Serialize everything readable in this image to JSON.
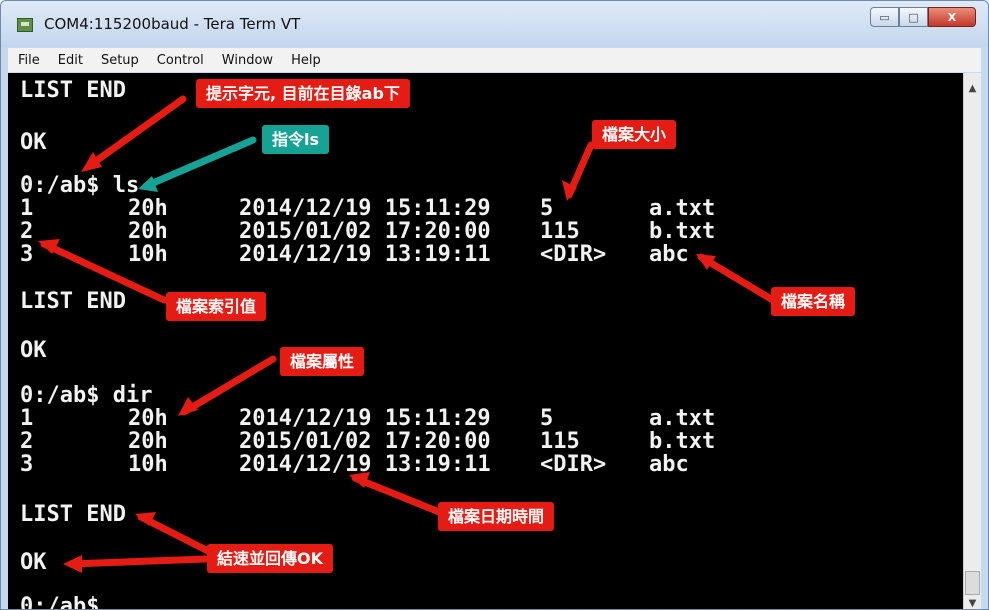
{
  "window": {
    "title": "COM4:115200baud - Tera Term VT",
    "buttons": {
      "minimize": "▭",
      "maximize": "□",
      "close": "X"
    }
  },
  "menu": [
    "File",
    "Edit",
    "Setup",
    "Control",
    "Window",
    "Help"
  ],
  "terminal": {
    "line1": "LIST END",
    "line2": "OK",
    "ls_prompt": "0:/ab$ ls",
    "rows1": [
      {
        "index": "1",
        "attr": "20h",
        "date": "2014/12/19 15:11:29",
        "size": "5",
        "name": "a.txt"
      },
      {
        "index": "2",
        "attr": "20h",
        "date": "2015/01/02 17:20:00",
        "size": "115",
        "name": "b.txt"
      },
      {
        "index": "3",
        "attr": "10h",
        "date": "2014/12/19 13:19:11",
        "size": "<DIR>",
        "name": "abc"
      }
    ],
    "list_end2": "LIST END",
    "ok2": "OK",
    "dir_prompt": "0:/ab$ dir",
    "rows2": [
      {
        "index": "1",
        "attr": "20h",
        "date": "2014/12/19 15:11:29",
        "size": "5",
        "name": "a.txt"
      },
      {
        "index": "2",
        "attr": "20h",
        "date": "2015/01/02 17:20:00",
        "size": "115",
        "name": "b.txt"
      },
      {
        "index": "3",
        "attr": "10h",
        "date": "2014/12/19 13:19:11",
        "size": "<DIR>",
        "name": "abc"
      }
    ],
    "list_end3": "LIST END",
    "ok3": "OK",
    "final_prompt": "0:/ab$"
  },
  "annotations": {
    "prompt": "提示字元, 目前在目錄ab下",
    "command_ls": "指令ls",
    "file_size": "檔案大小",
    "file_index": "檔案索引值",
    "file_name": "檔案名稱",
    "file_attr": "檔案屬性",
    "file_datetime": "檔案日期時間",
    "end_ok": "結速並回傳OK"
  },
  "colors": {
    "annotation_red": "#e51c13",
    "annotation_teal": "#16a294",
    "terminal_bg": "#000000",
    "terminal_text": "#f2f2f2"
  }
}
